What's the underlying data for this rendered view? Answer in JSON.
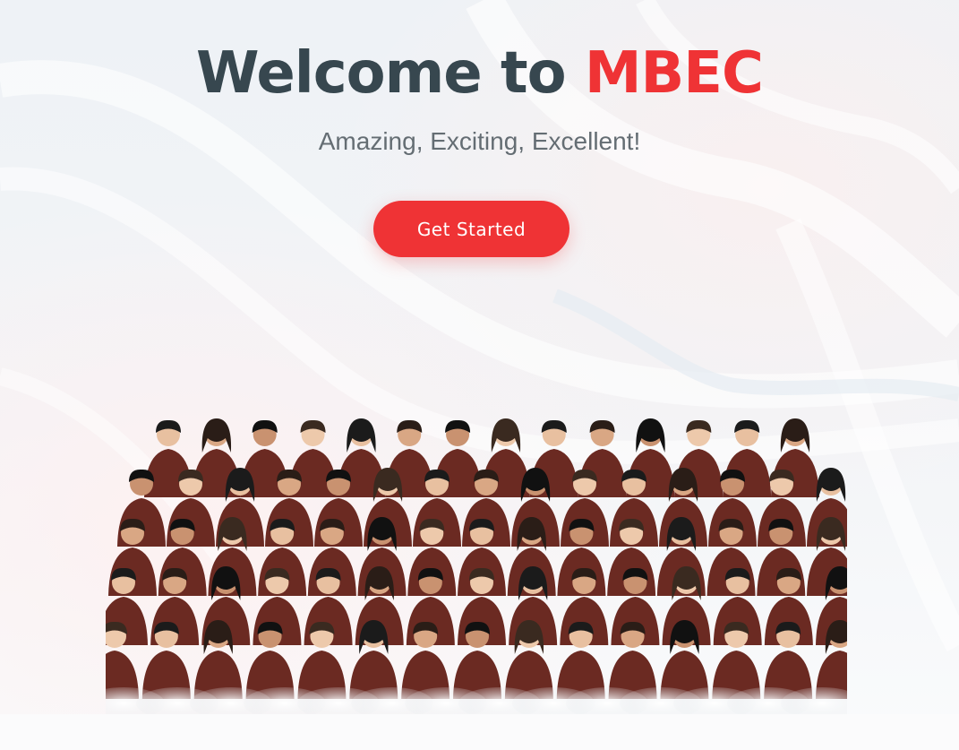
{
  "hero": {
    "title_prefix": "Welcome to ",
    "title_accent": "MBEC",
    "subtitle": "Amazing, Exciting, Excellent!",
    "cta_label": "Get Started"
  },
  "colors": {
    "accent": "#ef3335",
    "title": "#37474f",
    "subtitle": "#646d73",
    "uniform": "#6b2a22"
  },
  "images": {
    "group_photo": "group-photo-of-students-in-maroon-uniforms"
  }
}
